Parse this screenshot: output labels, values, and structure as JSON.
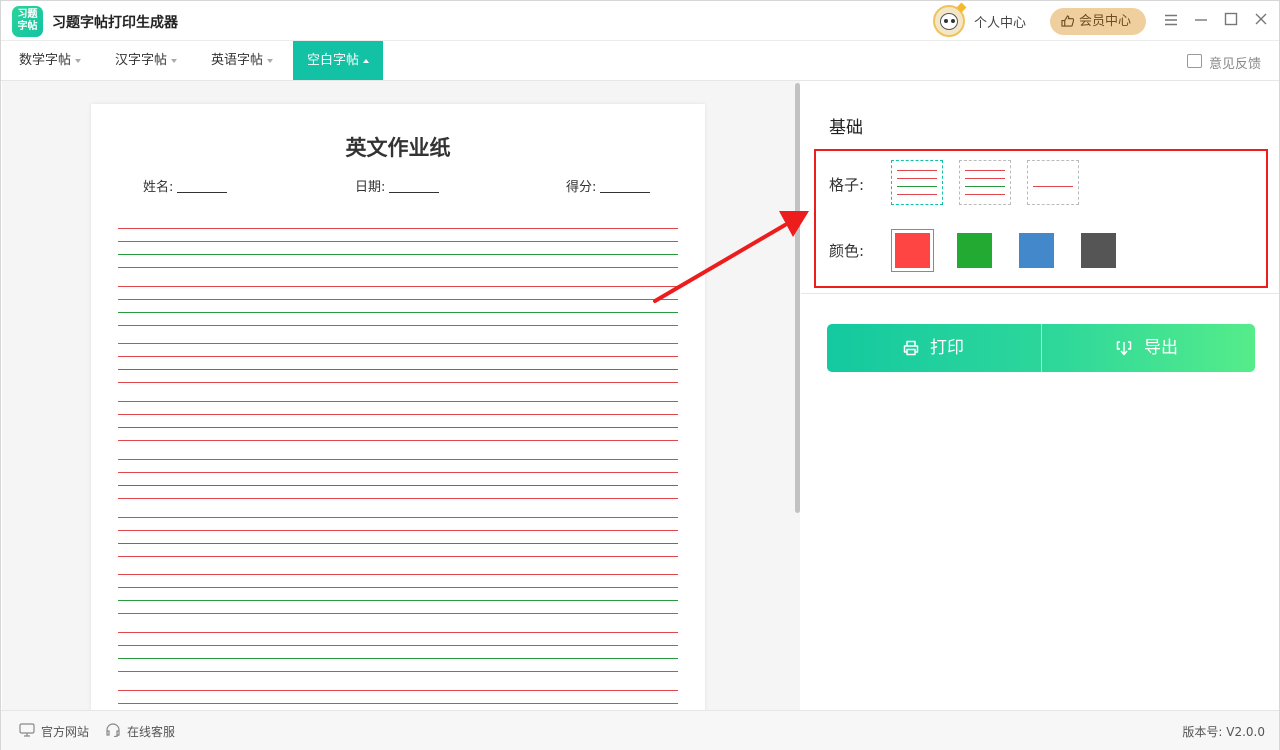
{
  "app": {
    "logo_text_top": "习题",
    "logo_text_bottom": "字帖",
    "title": "习题字帖打印生成器",
    "personal_center": "个人中心",
    "vip_center": "会员中心"
  },
  "menu": {
    "items": [
      {
        "label": "数学字帖"
      },
      {
        "label": "汉字字帖"
      },
      {
        "label": "英语字帖"
      },
      {
        "label": "空白字帖"
      }
    ],
    "active": "空白字帖",
    "feedback": "意见反馈"
  },
  "paper": {
    "title": "英文作业纸",
    "name_label": "姓名:",
    "date_label": "日期:",
    "score_label": "得分:"
  },
  "settings": {
    "section_title": "基础",
    "grid_label": "格子:",
    "color_label": "颜色:",
    "grid_options": [
      "four-line",
      "three-line",
      "single-line"
    ],
    "colors": [
      "#ff4444",
      "#22aa33",
      "#4488cc",
      "#555555"
    ],
    "selected_color": "#ff4444",
    "line_colors": {
      "red": "#e0474c",
      "green": "#2a9a3e"
    }
  },
  "actions": {
    "print": "打印",
    "export": "导出"
  },
  "status": {
    "website": "官方网站",
    "support": "在线客服",
    "version": "版本号: V2.0.0"
  }
}
